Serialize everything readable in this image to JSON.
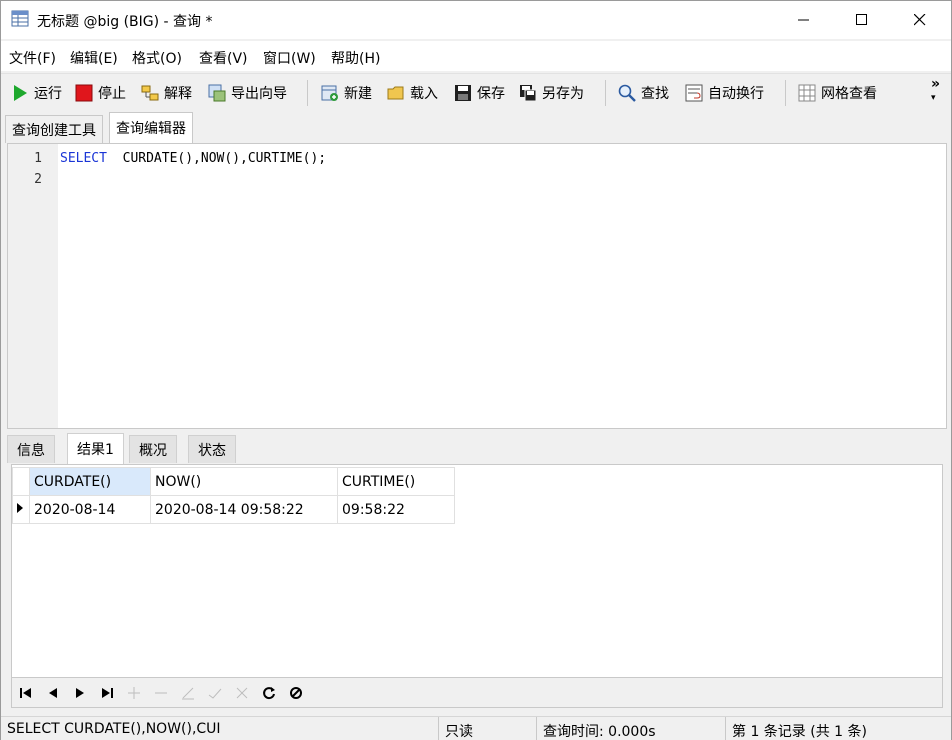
{
  "window": {
    "title": "无标题 @big (BIG) - 查询 *"
  },
  "menu": [
    "文件(F)",
    "编辑(E)",
    "格式(O)",
    "查看(V)",
    "窗口(W)",
    "帮助(H)"
  ],
  "toolbar": {
    "run": "运行",
    "stop": "停止",
    "explain": "解释",
    "export_wizard": "导出向导",
    "new": "新建",
    "load": "载入",
    "save": "保存",
    "save_as": "另存为",
    "find": "查找",
    "word_wrap": "自动换行",
    "grid_view": "网格查看",
    "more": "»"
  },
  "top_tabs": [
    "查询创建工具",
    "查询编辑器"
  ],
  "editor": {
    "lines": [
      {
        "no": "1",
        "keyword": "SELECT",
        "rest": "  CURDATE(),NOW(),CURTIME();"
      },
      {
        "no": "2",
        "keyword": "",
        "rest": ""
      }
    ]
  },
  "bottom_tabs": [
    "信息",
    "结果1",
    "概况",
    "状态"
  ],
  "result": {
    "columns": [
      "CURDATE()",
      "NOW()",
      "CURTIME()"
    ],
    "rows": [
      [
        "2020-08-14",
        "2020-08-14 09:58:22",
        "09:58:22"
      ]
    ]
  },
  "status": {
    "sql": "SELECT  CURDATE(),NOW(),CUI",
    "readonly": "只读",
    "query_time": "查询时间: 0.000s",
    "record": "第 1 条记录 (共 1 条)"
  },
  "colors": {
    "keyword": "#1a35d6",
    "selected_header": "#d9e9fb",
    "run_green": "#1ea82d",
    "stop_red": "#e0161c"
  }
}
